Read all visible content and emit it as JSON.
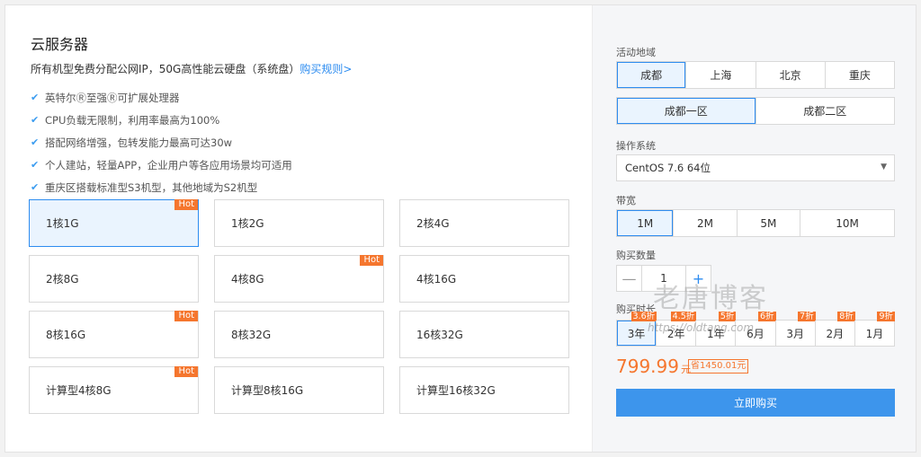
{
  "left": {
    "title": "云服务器",
    "subtitle": "所有机型免费分配公网IP，50G高性能云硬盘（系统盘）",
    "subtitle_link": "购买规则>",
    "features": [
      "英特尔Ⓡ至强Ⓡ可扩展处理器",
      "CPU负载无限制，利用率最高为100%",
      "搭配网络增强，包转发能力最高可达30w",
      "个人建站，轻量APP，企业用户等各应用场景均可适用",
      "重庆区搭载标准型S3机型，其他地域为S2机型"
    ],
    "hot_label": "Hot",
    "plans": [
      {
        "label": "1核1G",
        "hot": true,
        "selected": true
      },
      {
        "label": "1核2G",
        "hot": false,
        "selected": false
      },
      {
        "label": "2核4G",
        "hot": false,
        "selected": false
      },
      {
        "label": "2核8G",
        "hot": false,
        "selected": false
      },
      {
        "label": "4核8G",
        "hot": true,
        "selected": false
      },
      {
        "label": "4核16G",
        "hot": false,
        "selected": false
      },
      {
        "label": "8核16G",
        "hot": true,
        "selected": false
      },
      {
        "label": "8核32G",
        "hot": false,
        "selected": false
      },
      {
        "label": "16核32G",
        "hot": false,
        "selected": false
      },
      {
        "label": "计算型4核8G",
        "hot": true,
        "selected": false
      },
      {
        "label": "计算型8核16G",
        "hot": false,
        "selected": false
      },
      {
        "label": "计算型16核32G",
        "hot": false,
        "selected": false
      }
    ]
  },
  "right": {
    "region_label": "活动地域",
    "regions": [
      "成都",
      "上海",
      "北京",
      "重庆"
    ],
    "region_selected": 0,
    "zones": [
      "成都一区",
      "成都二区"
    ],
    "zone_selected": 0,
    "os_label": "操作系统",
    "os_value": "CentOS 7.6 64位",
    "bandwidth_label": "带宽",
    "bandwidths": [
      "1M",
      "2M",
      "5M",
      "10M"
    ],
    "bandwidth_selected": 0,
    "qty_label": "购买数量",
    "qty_minus": "—",
    "qty_value": "1",
    "qty_plus": "+",
    "duration_label": "购买时长",
    "durations": [
      {
        "label": "3年",
        "discount": "3.6折"
      },
      {
        "label": "2年",
        "discount": "4.5折"
      },
      {
        "label": "1年",
        "discount": "5折"
      },
      {
        "label": "6月",
        "discount": "6折"
      },
      {
        "label": "3月",
        "discount": "7折"
      },
      {
        "label": "2月",
        "discount": "8折"
      },
      {
        "label": "1月",
        "discount": "9折"
      }
    ],
    "duration_selected": 0,
    "price": "799.99",
    "price_unit": "元",
    "save": "省1450.01元",
    "buy_button": "立即购买"
  },
  "watermark": {
    "title": "老唐博客",
    "url": "https://oldtang.com"
  },
  "colors": {
    "accent": "#2d8cf0",
    "hot": "#f5762e",
    "buy_button": "#3d95ec"
  }
}
